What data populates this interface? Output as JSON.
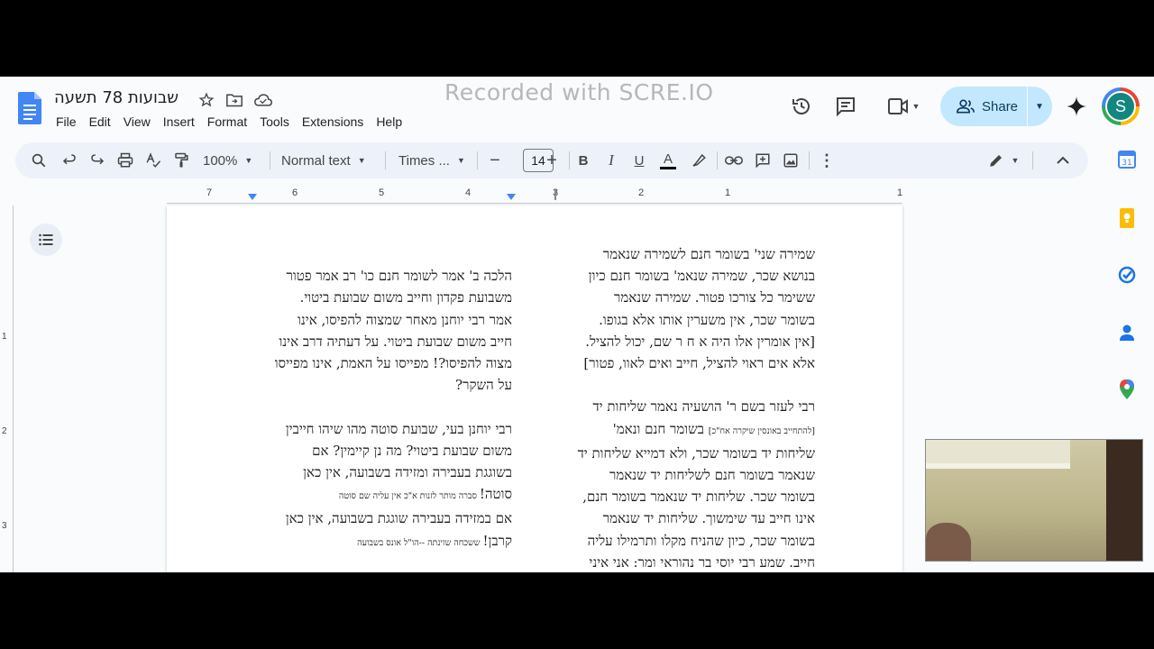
{
  "watermark": "Recorded with SCRE.IO",
  "document": {
    "title": "שבועות 78 תשעה"
  },
  "menu": [
    "File",
    "Edit",
    "View",
    "Insert",
    "Format",
    "Tools",
    "Extensions",
    "Help"
  ],
  "header": {
    "share_label": "Share",
    "avatar_letter": "S"
  },
  "toolbar": {
    "zoom": "100%",
    "style": "Normal text",
    "font": "Times ...",
    "font_size": "14",
    "minus": "−",
    "plus": "+",
    "bold": "B",
    "italic": "I",
    "underline": "U",
    "text_color": "A"
  },
  "ruler": {
    "numbers": [
      "7",
      "6",
      "5",
      "4",
      "3",
      "2",
      "1",
      "1"
    ]
  },
  "vruler": {
    "numbers": [
      "1",
      "2",
      "3"
    ]
  },
  "content": {
    "right_column": [
      "שמירה שני' בשומר חנם לשמירה שנאמר",
      "בנושא שכר, שמירה שנאמ' בשומר חנם כיון",
      "ששימר כל צורכו פטור.  שמירה שנאמר",
      "בשומר שכר, אין משערין אותו אלא בגופו.",
      "[אין אומרין אלו היה א ח ר שם, יכול להציל.",
      "אלא אים ראוי להציל, חייב ואים לאוו, פטור]",
      "",
      "רבי לעזר בשם ר' הושעיה נאמר שליחות יד",
      [
        "[להתחייב באונסין שיקרה אח\"כ]",
        " בשומר חנם ונאמ'"
      ],
      "שליחות יד בשומר שכר, ולא דמייא שליחות יד",
      "שנאמר בשומר חנם לשליחות יד שנאמר",
      "בשומר שכר. שליחות יד שנאמר בשומר חנם,",
      "אינו חייב עד שימשוך. שליחות יד שנאמר",
      "בשומר שכר, כיון שהניח מקלו ותרמילו עליה",
      "חייב. שמע רבי יוסי בר נהוראי ומר: אני איני"
    ],
    "left_column": [
      "",
      "הלכה ב'  אמר לשומר חנם כו' רב אמר פטור",
      "משבועת פקדון וחייב משום שבועת ביטוי.",
      "אמר רבי יוחנן מאחר שמצוה להפיסו, אינו",
      "חייב משום שבועת ביטוי. על דעתיה דרב אינו",
      "מצוה להפיסו?! מפייסו על האמת, אינו מפייסו",
      "על השקר?",
      "",
      "רבי יוחנן בעי, שבועת סוטה מהו שיהו חייבין",
      "משום שבועת ביטוי? מה נן קיימין? אם",
      "בשוגגת בעבירה ומזידה בשבועה, אין כאן",
      [
        "סוטה!",
        " סברה מותר לזנות א\"כ אין עליה שם סוטה"
      ],
      "אם במזידה בעבירה שוגגת בשבועה, אין כאן",
      [
        "קרבן!",
        "  ששכחה שזינתה --הו\"ל אונס בשבועה"
      ]
    ]
  }
}
